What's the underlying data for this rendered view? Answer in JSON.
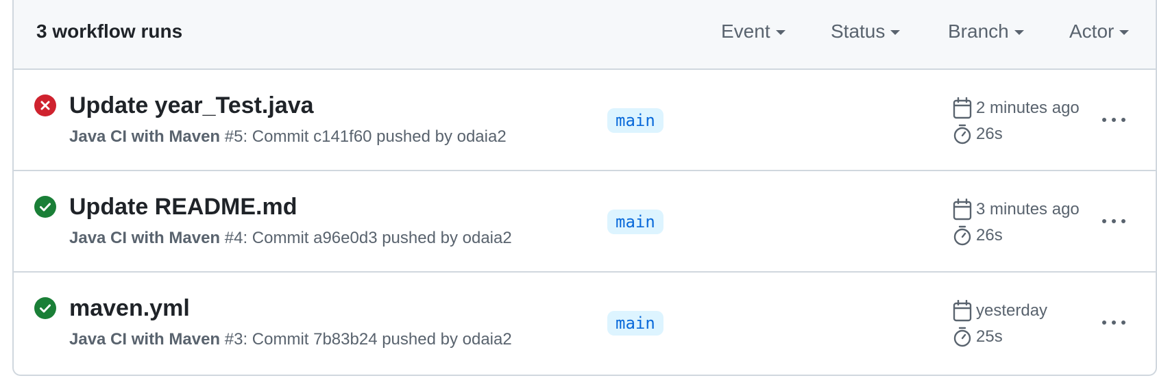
{
  "header": {
    "title": "3 workflow runs",
    "filters": {
      "event": "Event",
      "status": "Status",
      "branch": "Branch",
      "actor": "Actor"
    }
  },
  "runs": [
    {
      "status": "failure",
      "status_icon": "x-circle-fill-icon",
      "status_color": "#cf222e",
      "title": "Update year_Test.java",
      "workflow": "Java CI with Maven",
      "detail": " #5: Commit c141f60 pushed by odaia2",
      "branch": "main",
      "time_ago": "2 minutes ago",
      "duration": "26s"
    },
    {
      "status": "success",
      "status_icon": "check-circle-fill-icon",
      "status_color": "#1a7f37",
      "title": "Update README.md",
      "workflow": "Java CI with Maven",
      "detail": " #4: Commit a96e0d3 pushed by odaia2",
      "branch": "main",
      "time_ago": "3 minutes ago",
      "duration": "26s"
    },
    {
      "status": "success",
      "status_icon": "check-circle-fill-icon",
      "status_color": "#1a7f37",
      "title": "maven.yml",
      "workflow": "Java CI with Maven",
      "detail": " #3: Commit 7b83b24 pushed by odaia2",
      "branch": "main",
      "time_ago": "yesterday",
      "duration": "25s"
    }
  ]
}
